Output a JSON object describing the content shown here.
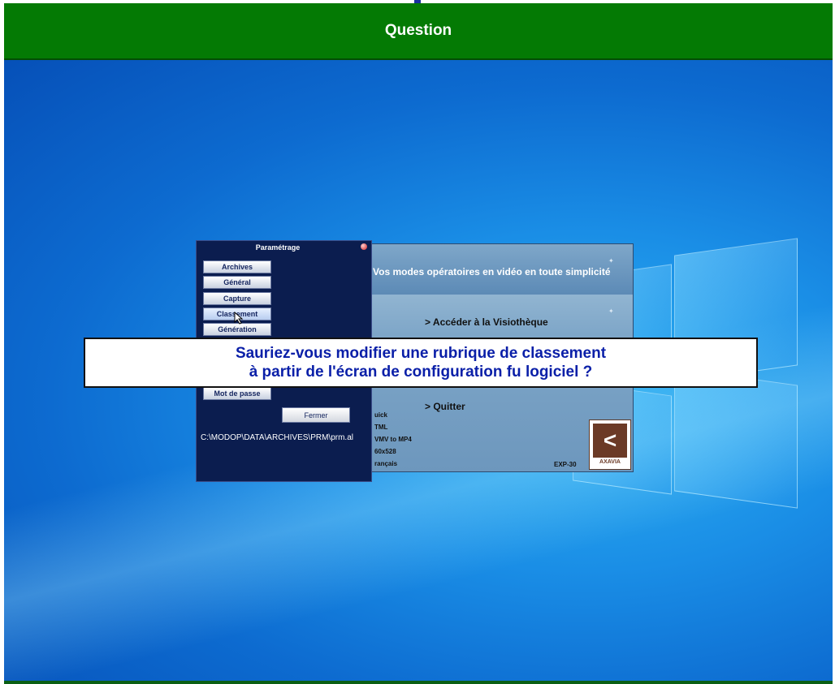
{
  "header": {
    "title": "Question"
  },
  "question": {
    "line1": "Sauriez-vous modifier une rubrique de classement",
    "line2": "à partir de l'écran de configuration fu logiciel ?"
  },
  "param_dialog": {
    "title": "Paramétrage",
    "buttons": [
      "Archives",
      "Général",
      "Capture",
      "Classement",
      "Génération"
    ],
    "mot_de_passe": "Mot de passe",
    "fermer": "Fermer",
    "path": "C:\\MODOP\\DATA\\ARCHIVES\\PRM\\prm.al"
  },
  "app_splash": {
    "tagline": "Vos modes opératoires en vidéo en toute simplicité",
    "menu_visiotheque": "> Accéder à la Visiothèque",
    "menu_quitter": "> Quitter",
    "info": [
      "uick",
      "TML",
      "VMV to MP4",
      "60x528",
      "rançais"
    ],
    "version": "EXP-30",
    "brand": "AXAVIA"
  },
  "colors": {
    "header_bg": "#047a04",
    "question_text": "#0a1fa8",
    "dialog_bg": "#0b1d4f"
  }
}
